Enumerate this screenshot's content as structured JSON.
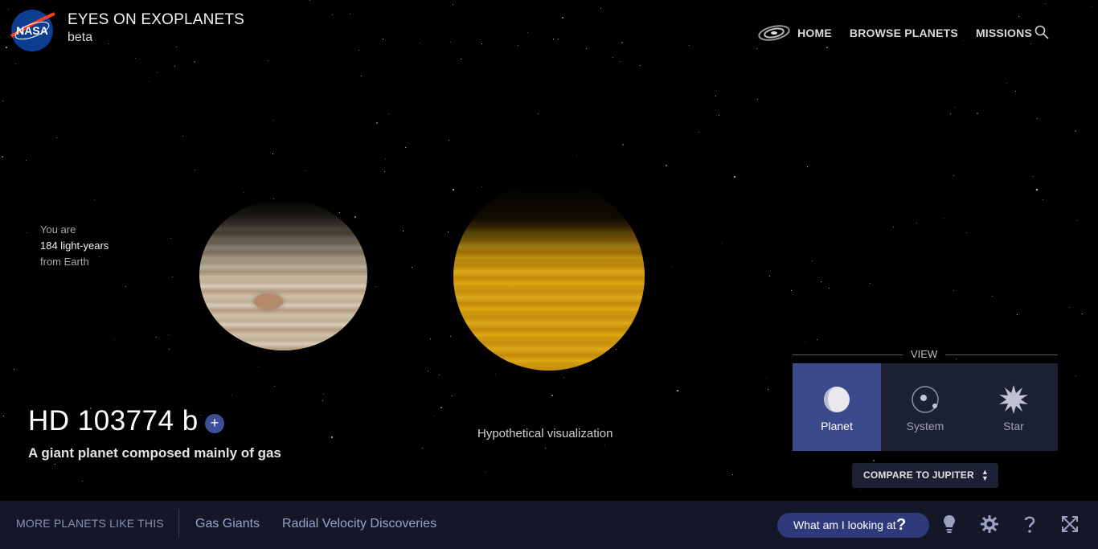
{
  "header": {
    "logo_text": "NASA",
    "title": "EYES ON EXOPLANETS",
    "subtitle": "beta",
    "nav": [
      "HOME",
      "BROWSE PLANETS",
      "MISSIONS"
    ]
  },
  "distance": {
    "line1": "You are",
    "line2": "184 light-years",
    "line3": "from Earth"
  },
  "planet": {
    "name": "HD 103774 b",
    "add_label": "+",
    "description": "A giant planet composed mainly of gas",
    "visual_caption": "Hypothetical visualization"
  },
  "view": {
    "label": "VIEW",
    "options": [
      "Planet",
      "System",
      "Star"
    ],
    "selected": "Planet"
  },
  "compare": {
    "label": "COMPARE TO JUPITER"
  },
  "bottom": {
    "more_label": "MORE PLANETS LIKE THIS",
    "categories": [
      "Gas Giants",
      "Radial Velocity Discoveries"
    ],
    "help_label": "What am I looking at",
    "help_q": "?"
  },
  "colors": {
    "accent": "#3a4a8c",
    "panel": "#1c2033",
    "bar": "#141728"
  }
}
